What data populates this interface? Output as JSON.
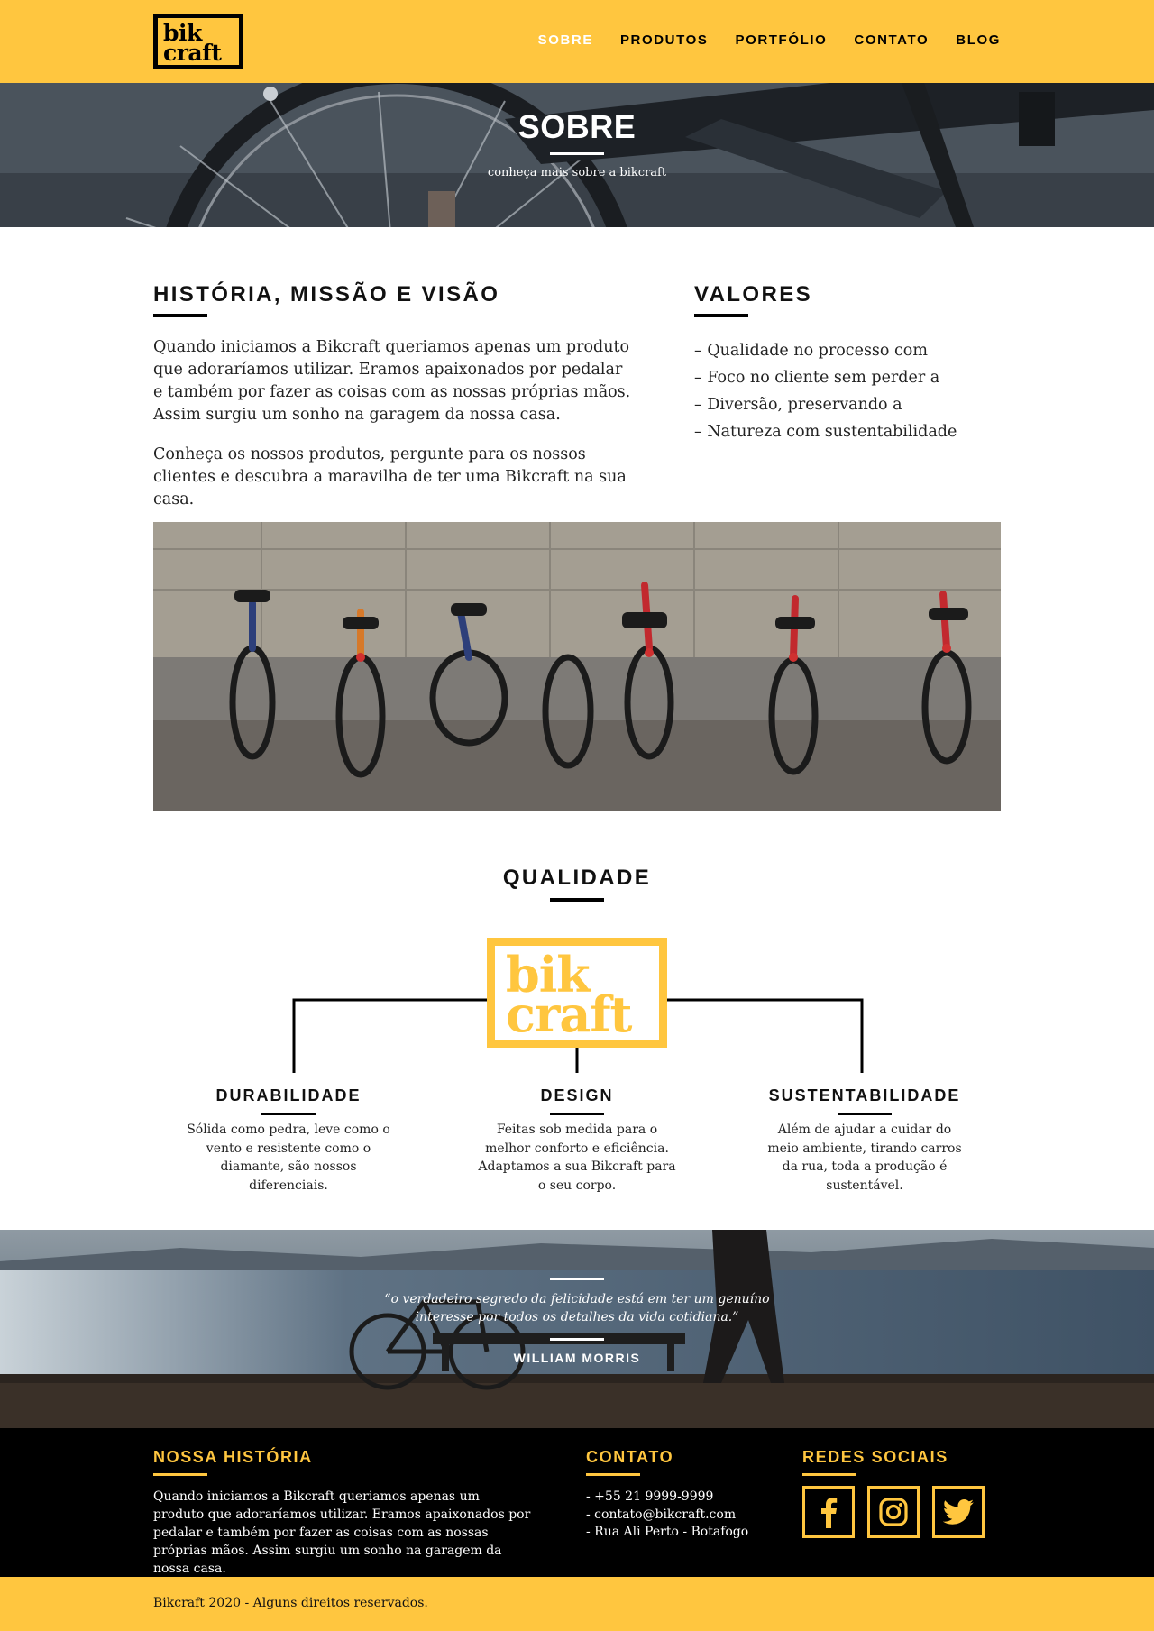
{
  "header": {
    "logo_line1": "bik",
    "logo_line2": "craft",
    "nav": [
      {
        "label": "SOBRE",
        "active": true
      },
      {
        "label": "PRODUTOS",
        "active": false
      },
      {
        "label": "PORTFÓLIO",
        "active": false
      },
      {
        "label": "CONTATO",
        "active": false
      },
      {
        "label": "BLOG",
        "active": false
      }
    ]
  },
  "hero": {
    "title": "SOBRE",
    "subtitle": "conheça mais sobre a bikcraft"
  },
  "historia": {
    "title": "HISTÓRIA, MISSÃO E VISÃO",
    "paragraph1": "Quando iniciamos a Bikcraft queriamos apenas um produto que adoraríamos utilizar. Eramos apaixonados por pedalar e também por fazer as coisas com as nossas próprias mãos. Assim surgiu um sonho na garagem da nossa casa.",
    "paragraph2": "Conheça os nossos produtos, pergunte para os nossos clientes e descubra a maravilha de ter uma Bikcraft na sua casa."
  },
  "valores": {
    "title": "VALORES",
    "items": [
      "– Qualidade no processo com",
      "– Foco no cliente sem perder a",
      "– Diversão, preservando a",
      "– Natureza com sustentabilidade"
    ]
  },
  "qualidade": {
    "title": "QUALIDADE",
    "logo_line1": "bik",
    "logo_line2": "craft",
    "features": [
      {
        "title": "DURABILIDADE",
        "text": "Sólida como pedra, leve como o vento e resistente como o diamante, são nossos diferenciais."
      },
      {
        "title": "DESIGN",
        "text": "Feitas sob medida para o melhor conforto e eficiência. Adaptamos a sua Bikcraft para o seu corpo."
      },
      {
        "title": "SUSTENTABILIDADE",
        "text": "Além de ajudar a cuidar do meio ambiente, tirando carros da rua, toda a produção é sustentável."
      }
    ]
  },
  "quote": {
    "text": "“o verdadeiro segredo da felicidade está em ter um genuíno interesse por todos os detalhes da vida cotidiana.”",
    "author": "WILLIAM MORRIS"
  },
  "footer": {
    "historia_title": "NOSSA HISTÓRIA",
    "historia_text": "Quando iniciamos a Bikcraft queriamos apenas um produto que adoraríamos utilizar. Eramos apaixonados por pedalar e também por fazer as coisas com as nossas próprias mãos. Assim surgiu um sonho na garagem da nossa casa.",
    "contato_title": "CONTATO",
    "contato_items": [
      "- +55 21 9999-9999",
      "- contato@bikcraft.com",
      "- Rua Ali Perto - Botafogo"
    ],
    "redes_title": "REDES SOCIAIS",
    "social_icons": [
      "facebook-icon",
      "instagram-icon",
      "twitter-icon"
    ],
    "copyright": "Bikcraft 2020 - Alguns direitos reservados."
  },
  "colors": {
    "brand_yellow": "#ffc63f",
    "black": "#000000",
    "white": "#ffffff"
  }
}
